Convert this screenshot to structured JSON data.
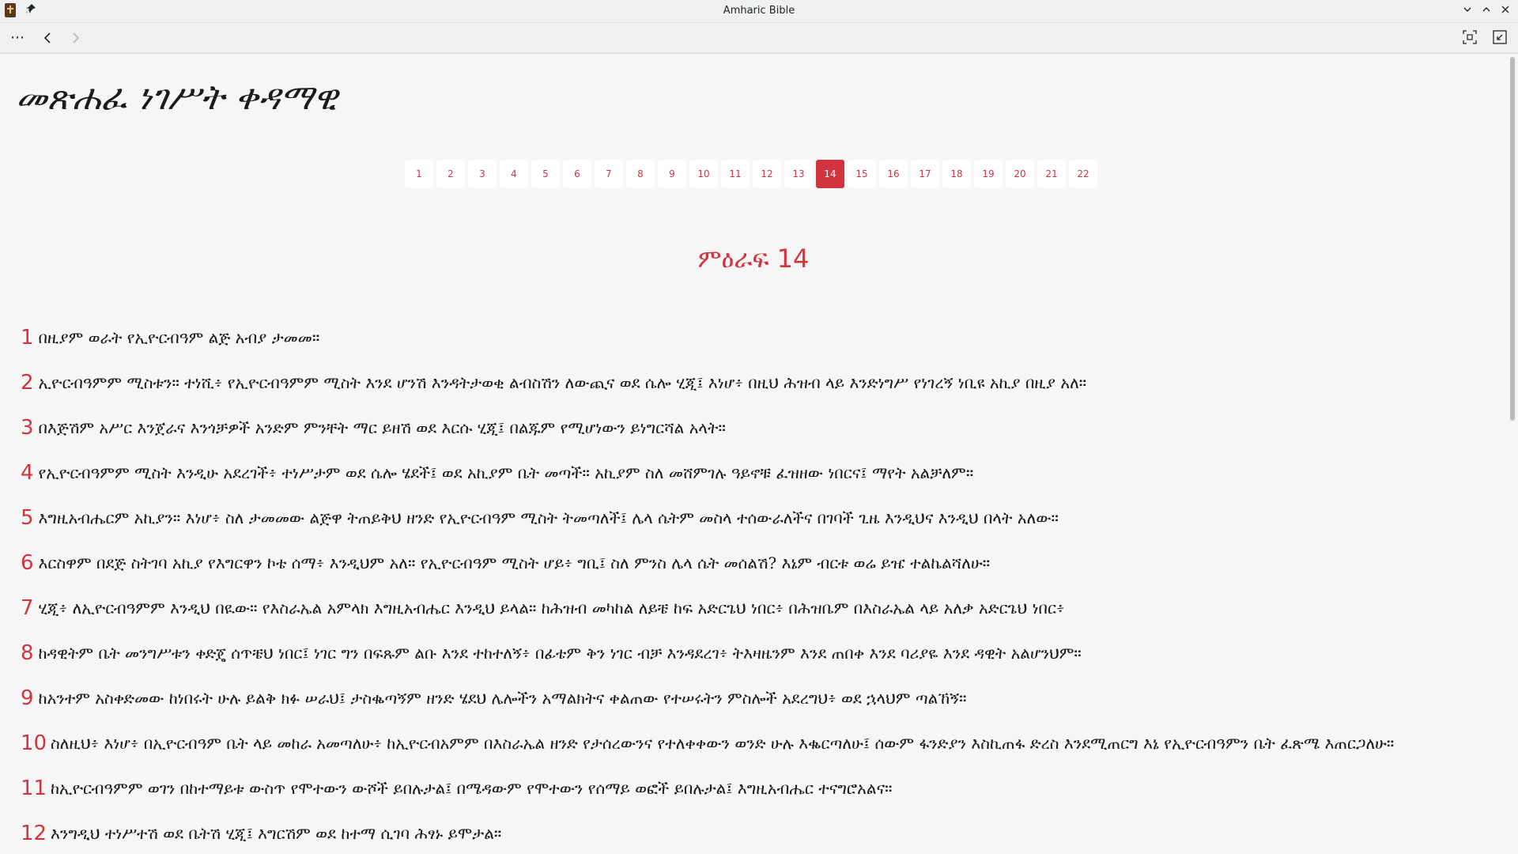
{
  "window": {
    "title": "Amharic Bible",
    "pin_glyph": "📌",
    "minimize_glyph": "⌄",
    "maximize_glyph": "⌃",
    "close_glyph": "✕"
  },
  "toolbar": {
    "menu_glyph": "⋯",
    "back_glyph": "‹",
    "forward_glyph": "›"
  },
  "book": {
    "title": "መጽሐፈ ነገሥት ቀዳማዊ"
  },
  "pager": {
    "pages": [
      "1",
      "2",
      "3",
      "4",
      "5",
      "6",
      "7",
      "8",
      "9",
      "10",
      "11",
      "12",
      "13",
      "14",
      "15",
      "16",
      "17",
      "18",
      "19",
      "20",
      "21",
      "22"
    ],
    "active": "14"
  },
  "chapter": {
    "heading": "ምዕራፍ 14"
  },
  "verses": [
    {
      "num": "1",
      "text": "በዚያም ወራት የኢዮርብዓም ልጅ አብያ ታመመ።"
    },
    {
      "num": "2",
      "text": "ኢዮርብዓምም ሚስቱን። ተነሺ፥ የኢዮርብዓምም ሚስት እንደ ሆንሽ እንዳትታወቂ ልብስሽን ለውጪና ወደ ሴሎ ሂጂ፤ እነሆ፥ በዚህ ሕዝብ ላይ እንድነግሥ የነገረኝ ነቢዩ አኪያ በዚያ አለ።"
    },
    {
      "num": "3",
      "text": "በእጅሽም አሥር እንጀራና እንጎቻዎች አንድም ምንቸት ማር ይዘሽ ወደ እርሱ ሂጂ፤ በልጁም የሚሆነውን ይነግርሻል አላት።"
    },
    {
      "num": "4",
      "text": "የኢዮርብዓምም ሚስት እንዲሁ አደረገች፥ ተነሥታም ወደ ሴሎ ሄደች፤ ወደ አኪያም ቤት መጣች። አኪያም ስለ መሸምገሉ ዓይኖቹ ፈዝዘው ነበርና፤ ማየት አልቻለም።"
    },
    {
      "num": "5",
      "text": "እግዚአብሔርም አኪያን። እነሆ፥ ስለ ታመመው ልጅዋ ትጠይቅህ ዘንድ የኢዮርብዓም ሚስት ትመጣለች፤ ሌላ ሴትም መስላ ተሰውራለችና በገባች ጊዜ እንዲህና እንዲህ በላት አለው።"
    },
    {
      "num": "6",
      "text": "እርስዋም በደጅ ስትገባ አኪያ የእግርዋን ኮቴ ሰማ፥ እንዲህም አለ። የኢዮርብዓም ሚስት ሆይ፥ ግቢ፤ ስለ ምንስ ሌላ ሴት መሰልሽ? እኔም ብርቱ ወሬ ይዤ ተልኬልሻለሁ።"
    },
    {
      "num": "7",
      "text": "ሂጂ፥ ለኢዮርብዓምም እንዲህ በዪው። የእስራኤል አምላክ እግዚአብሔር እንዲህ ይላል። ከሕዝብ መካከል ለይቼ ከፍ አድርጌህ ነበር፥ በሕዝቤም በእስራኤል ላይ አለቃ አድርጌህ ነበር፥"
    },
    {
      "num": "8",
      "text": "ከዳዊትም ቤት መንግሥቱን ቀድጄ ሰጥቼህ ነበር፤ ነገር ግን በፍጹም ልቡ እንደ ተከተለኝ፥ በፊቴም ቅን ነገር ብቻ እንዳደረገ፥ ትእዛዜንም እንደ ጠበቀ እንደ ባሪያዬ እንደ ዳዊት አልሆንህም።"
    },
    {
      "num": "9",
      "text": "ከአንተም አስቀድመው ከነበሩት ሁሉ ይልቅ ክፉ ሠራህ፤ ታስቈጣኝም ዘንድ ሄደህ ሌሎችን አማልክትና ቀልጠው የተሠሩትን ምስሎች አደረግህ፥ ወደ ኋላህም ጣልኸኝ።"
    },
    {
      "num": "10",
      "text": "ስለዚህ፥ እነሆ፥ በኢዮርብዓም ቤት ላይ መከራ አመጣለሁ፥ ከኢዮርብአምም በእስራኤል ዘንድ የታሰረውንና የተለቀቀውን ወንድ ሁሉ እቈርጣለሁ፤ ሰውም ፋንድያን እስኪጠፋ ድረስ እንደሚጠርግ እኔ የኢዮርብዓምን ቤት ፈጽሜ እጠርጋለሁ።"
    },
    {
      "num": "11",
      "text": "ከኢዮርብዓምም ወገን በከተማይቱ ውስጥ የሞተውን ውሾች ይበሉታል፤ በሜዳውም የሞተውን የሰማይ ወፎች ይበሉታል፤ እግዚአብሔር ተናግሮአልና።"
    },
    {
      "num": "12",
      "text": "እንግዲህ ተነሥተሽ ወደ ቤትሽ ሂጂ፤ እግርሽም ወደ ከተማ ሲገባ ሕፃኑ ይሞታል።"
    }
  ],
  "colors": {
    "accent": "#d2343f",
    "background": "#f6f6f6",
    "text": "#1b1b1b"
  }
}
